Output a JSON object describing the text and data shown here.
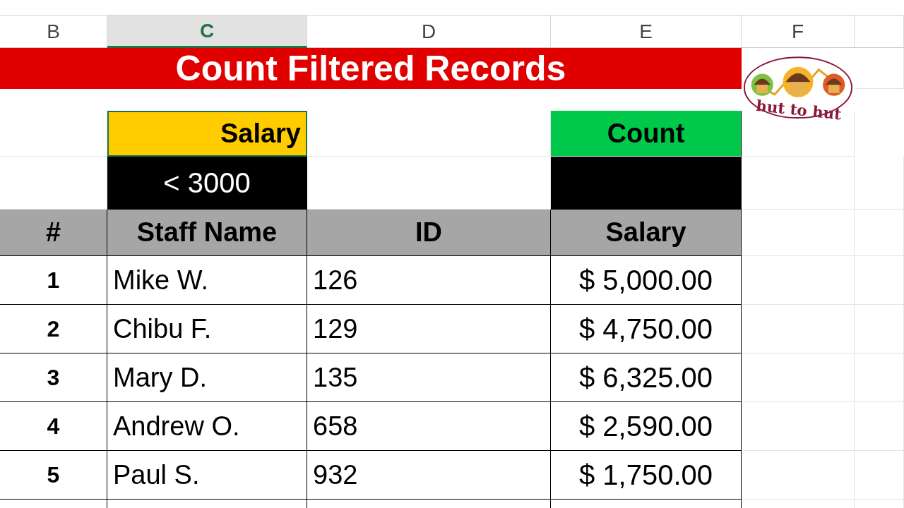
{
  "column_headers": [
    {
      "label": "B",
      "selected": false
    },
    {
      "label": "C",
      "selected": true
    },
    {
      "label": "D",
      "selected": false
    },
    {
      "label": "E",
      "selected": false
    },
    {
      "label": "F",
      "selected": false
    }
  ],
  "title": "Count Filtered Records",
  "logo": {
    "text": "hut to hut"
  },
  "criteria": {
    "header": "Salary",
    "value": "< 3000",
    "selected": true
  },
  "count": {
    "header": "Count"
  },
  "table": {
    "columns": [
      "#",
      "Staff Name",
      "ID",
      "Salary"
    ],
    "rows": [
      {
        "num": "1",
        "name": "Mike W.",
        "id": "126",
        "salary": "$ 5,000.00"
      },
      {
        "num": "2",
        "name": "Chibu F.",
        "id": "129",
        "salary": "$ 4,750.00"
      },
      {
        "num": "3",
        "name": "Mary D.",
        "id": "135",
        "salary": "$ 6,325.00"
      },
      {
        "num": "4",
        "name": "Andrew O.",
        "id": "658",
        "salary": "$ 2,590.00"
      },
      {
        "num": "5",
        "name": "Paul S.",
        "id": "932",
        "salary": "$ 1,750.00"
      }
    ]
  }
}
